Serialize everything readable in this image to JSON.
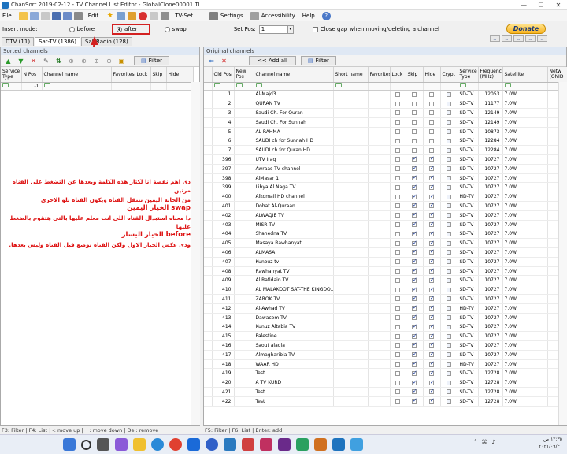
{
  "window": {
    "title": "ChanSort 2019-02-12 - TV Channel List Editor - GlobalClone00001.TLL",
    "minimize": "—",
    "maximize": "☐",
    "close": "✕"
  },
  "menu": {
    "file": "File",
    "edit": "Edit",
    "tvset": "TV-Set",
    "settings": "Settings",
    "accessibility": "Accessibility",
    "help": "Help"
  },
  "options": {
    "insert_mode_label": "Insert mode:",
    "before": "before",
    "after": "after",
    "swap": "swap",
    "setpos_label": "Set Pos:",
    "setpos_value": "1",
    "close_gap": "Close gap when moving/deleting a channel",
    "donate": "Donate"
  },
  "tabs": [
    "DTV (11)",
    "Sat-TV (1386)",
    "Sat-Radio (128)"
  ],
  "left": {
    "header": "Sorted channels",
    "filter": "Filter",
    "columns": [
      "Service Type",
      "N Pos",
      "Channel name",
      "Favorites",
      "Lock",
      "Skip",
      "Hide"
    ],
    "filter_value": "-1"
  },
  "right": {
    "header": "Original channels",
    "add_all": "<< Add all",
    "filter": "Filter",
    "columns": [
      "Old Pos",
      "New Pos",
      "Channel name",
      "Short name",
      "Favorites",
      "Lock",
      "Skip",
      "Hide",
      "Crypt",
      "Service Type",
      "Frequency (MHz)",
      "Satellite",
      "Netw (ONID"
    ],
    "rows": [
      {
        "old": "1",
        "name": "Al-Majd3",
        "skip": false,
        "hide": false,
        "type": "SD-TV",
        "freq": "12053",
        "sat": "7.0W"
      },
      {
        "old": "2",
        "name": "QURAN TV",
        "skip": false,
        "hide": false,
        "type": "SD-TV",
        "freq": "11177",
        "sat": "7.0W"
      },
      {
        "old": "3",
        "name": "Saudi Ch. For Quran",
        "skip": false,
        "hide": false,
        "type": "SD-TV",
        "freq": "12149",
        "sat": "7.0W"
      },
      {
        "old": "4",
        "name": "Saudi Ch. For Sunnah",
        "skip": false,
        "hide": false,
        "type": "SD-TV",
        "freq": "12149",
        "sat": "7.0W"
      },
      {
        "old": "5",
        "name": "AL RAHMA",
        "skip": false,
        "hide": false,
        "type": "SD-TV",
        "freq": "10873",
        "sat": "7.0W"
      },
      {
        "old": "6",
        "name": "SAUDI ch for Sunnah HD",
        "skip": false,
        "hide": false,
        "type": "SD-TV",
        "freq": "12284",
        "sat": "7.0W"
      },
      {
        "old": "7",
        "name": "SAUDI ch for Quran HD",
        "skip": false,
        "hide": false,
        "type": "SD-TV",
        "freq": "12284",
        "sat": "7.0W"
      },
      {
        "old": "396",
        "name": "UTV Iraq",
        "skip": true,
        "hide": true,
        "type": "SD-TV",
        "freq": "10727",
        "sat": "7.0W"
      },
      {
        "old": "397",
        "name": "Awraas TV channel",
        "skip": true,
        "hide": true,
        "type": "SD-TV",
        "freq": "10727",
        "sat": "7.0W"
      },
      {
        "old": "398",
        "name": "AlMasar 1",
        "skip": true,
        "hide": true,
        "type": "SD-TV",
        "freq": "10727",
        "sat": "7.0W"
      },
      {
        "old": "399",
        "name": "Libya Al Naga TV",
        "skip": true,
        "hide": true,
        "type": "SD-TV",
        "freq": "10727",
        "sat": "7.0W"
      },
      {
        "old": "400",
        "name": "Alkomail HD channel",
        "skip": true,
        "hide": true,
        "type": "HD-TV",
        "freq": "10727",
        "sat": "7.0W"
      },
      {
        "old": "401",
        "name": "Dohat Al-Quraan",
        "skip": true,
        "hide": true,
        "type": "SD-TV",
        "freq": "10727",
        "sat": "7.0W"
      },
      {
        "old": "402",
        "name": "ALWAQIE TV",
        "skip": true,
        "hide": true,
        "type": "SD-TV",
        "freq": "10727",
        "sat": "7.0W"
      },
      {
        "old": "403",
        "name": "MISR TV",
        "skip": true,
        "hide": true,
        "type": "SD-TV",
        "freq": "10727",
        "sat": "7.0W"
      },
      {
        "old": "404",
        "name": "Shahedna TV",
        "skip": true,
        "hide": true,
        "type": "SD-TV",
        "freq": "10727",
        "sat": "7.0W"
      },
      {
        "old": "405",
        "name": "Masaya Rawhanyat",
        "skip": true,
        "hide": true,
        "type": "SD-TV",
        "freq": "10727",
        "sat": "7.0W"
      },
      {
        "old": "406",
        "name": "ALMASA",
        "skip": true,
        "hide": true,
        "type": "SD-TV",
        "freq": "10727",
        "sat": "7.0W"
      },
      {
        "old": "407",
        "name": "Kunouz tv",
        "skip": true,
        "hide": true,
        "type": "SD-TV",
        "freq": "10727",
        "sat": "7.0W"
      },
      {
        "old": "408",
        "name": "Rawhanyat TV",
        "skip": true,
        "hide": true,
        "type": "SD-TV",
        "freq": "10727",
        "sat": "7.0W"
      },
      {
        "old": "409",
        "name": "Al Rafidain TV",
        "skip": true,
        "hide": true,
        "type": "SD-TV",
        "freq": "10727",
        "sat": "7.0W"
      },
      {
        "old": "410",
        "name": "AL MALAKOOT SAT-THE KINGDO...",
        "skip": true,
        "hide": true,
        "type": "SD-TV",
        "freq": "10727",
        "sat": "7.0W"
      },
      {
        "old": "411",
        "name": "ZAROK TV",
        "skip": true,
        "hide": true,
        "type": "SD-TV",
        "freq": "10727",
        "sat": "7.0W"
      },
      {
        "old": "412",
        "name": "Al-Awhad TV",
        "skip": true,
        "hide": true,
        "type": "HD-TV",
        "freq": "10727",
        "sat": "7.0W"
      },
      {
        "old": "413",
        "name": "Dawacom TV",
        "skip": true,
        "hide": true,
        "type": "SD-TV",
        "freq": "10727",
        "sat": "7.0W"
      },
      {
        "old": "414",
        "name": "Kunuz Altabia TV",
        "skip": true,
        "hide": true,
        "type": "SD-TV",
        "freq": "10727",
        "sat": "7.0W"
      },
      {
        "old": "415",
        "name": "Palestine",
        "skip": true,
        "hide": true,
        "type": "SD-TV",
        "freq": "10727",
        "sat": "7.0W"
      },
      {
        "old": "416",
        "name": "Saout alaqla",
        "skip": true,
        "hide": true,
        "type": "SD-TV",
        "freq": "10727",
        "sat": "7.0W"
      },
      {
        "old": "417",
        "name": "Almagharibia TV",
        "skip": true,
        "hide": true,
        "type": "SD-TV",
        "freq": "10727",
        "sat": "7.0W"
      },
      {
        "old": "418",
        "name": "WAAR HD",
        "skip": true,
        "hide": true,
        "type": "HD-TV",
        "freq": "10727",
        "sat": "7.0W"
      },
      {
        "old": "419",
        "name": "Test",
        "skip": true,
        "hide": true,
        "type": "SD-TV",
        "freq": "12728",
        "sat": "7.0W"
      },
      {
        "old": "420",
        "name": "A TV KURD",
        "skip": true,
        "hide": true,
        "type": "SD-TV",
        "freq": "12728",
        "sat": "7.0W"
      },
      {
        "old": "421",
        "name": "Test",
        "skip": true,
        "hide": true,
        "type": "SD-TV",
        "freq": "12728",
        "sat": "7.0W"
      },
      {
        "old": "422",
        "name": "Test",
        "skip": true,
        "hide": true,
        "type": "SD-TV",
        "freq": "12728",
        "sat": "7.0W"
      }
    ]
  },
  "annotation": {
    "line1": "دى اهم نقصة انا لكتار هذه الكلمة وبعدها عن التضغط على القناه مرتين",
    "line2": "من الخانه اليمين تتنقل القناه ويكون القناه تلو الاخرى",
    "line3": "swap الخيار اليمين",
    "line4": "دا معناه استبدال القناه اللى انت معلم عليها بالتى هتقوم بالضغط عليها",
    "line5": "before الخيار اليسار",
    "line6": "ودى عكس الخيار الاول ولكن القناه توضع قبل القناه وليس بعدها."
  },
  "status": {
    "left": "F3: Filter | F4: List | -: move up | +: move down | Del: remove",
    "right": "F5: Filter | F6: List | Enter: add"
  },
  "clock": {
    "time": "١٢:٣٥ ص",
    "date": "٢٠٢١/٠٩/٣٠"
  },
  "colors": {
    "accent_red": "#d32020",
    "panel_head": "#dfe8f4",
    "donate_yellow": "#f9b421"
  }
}
